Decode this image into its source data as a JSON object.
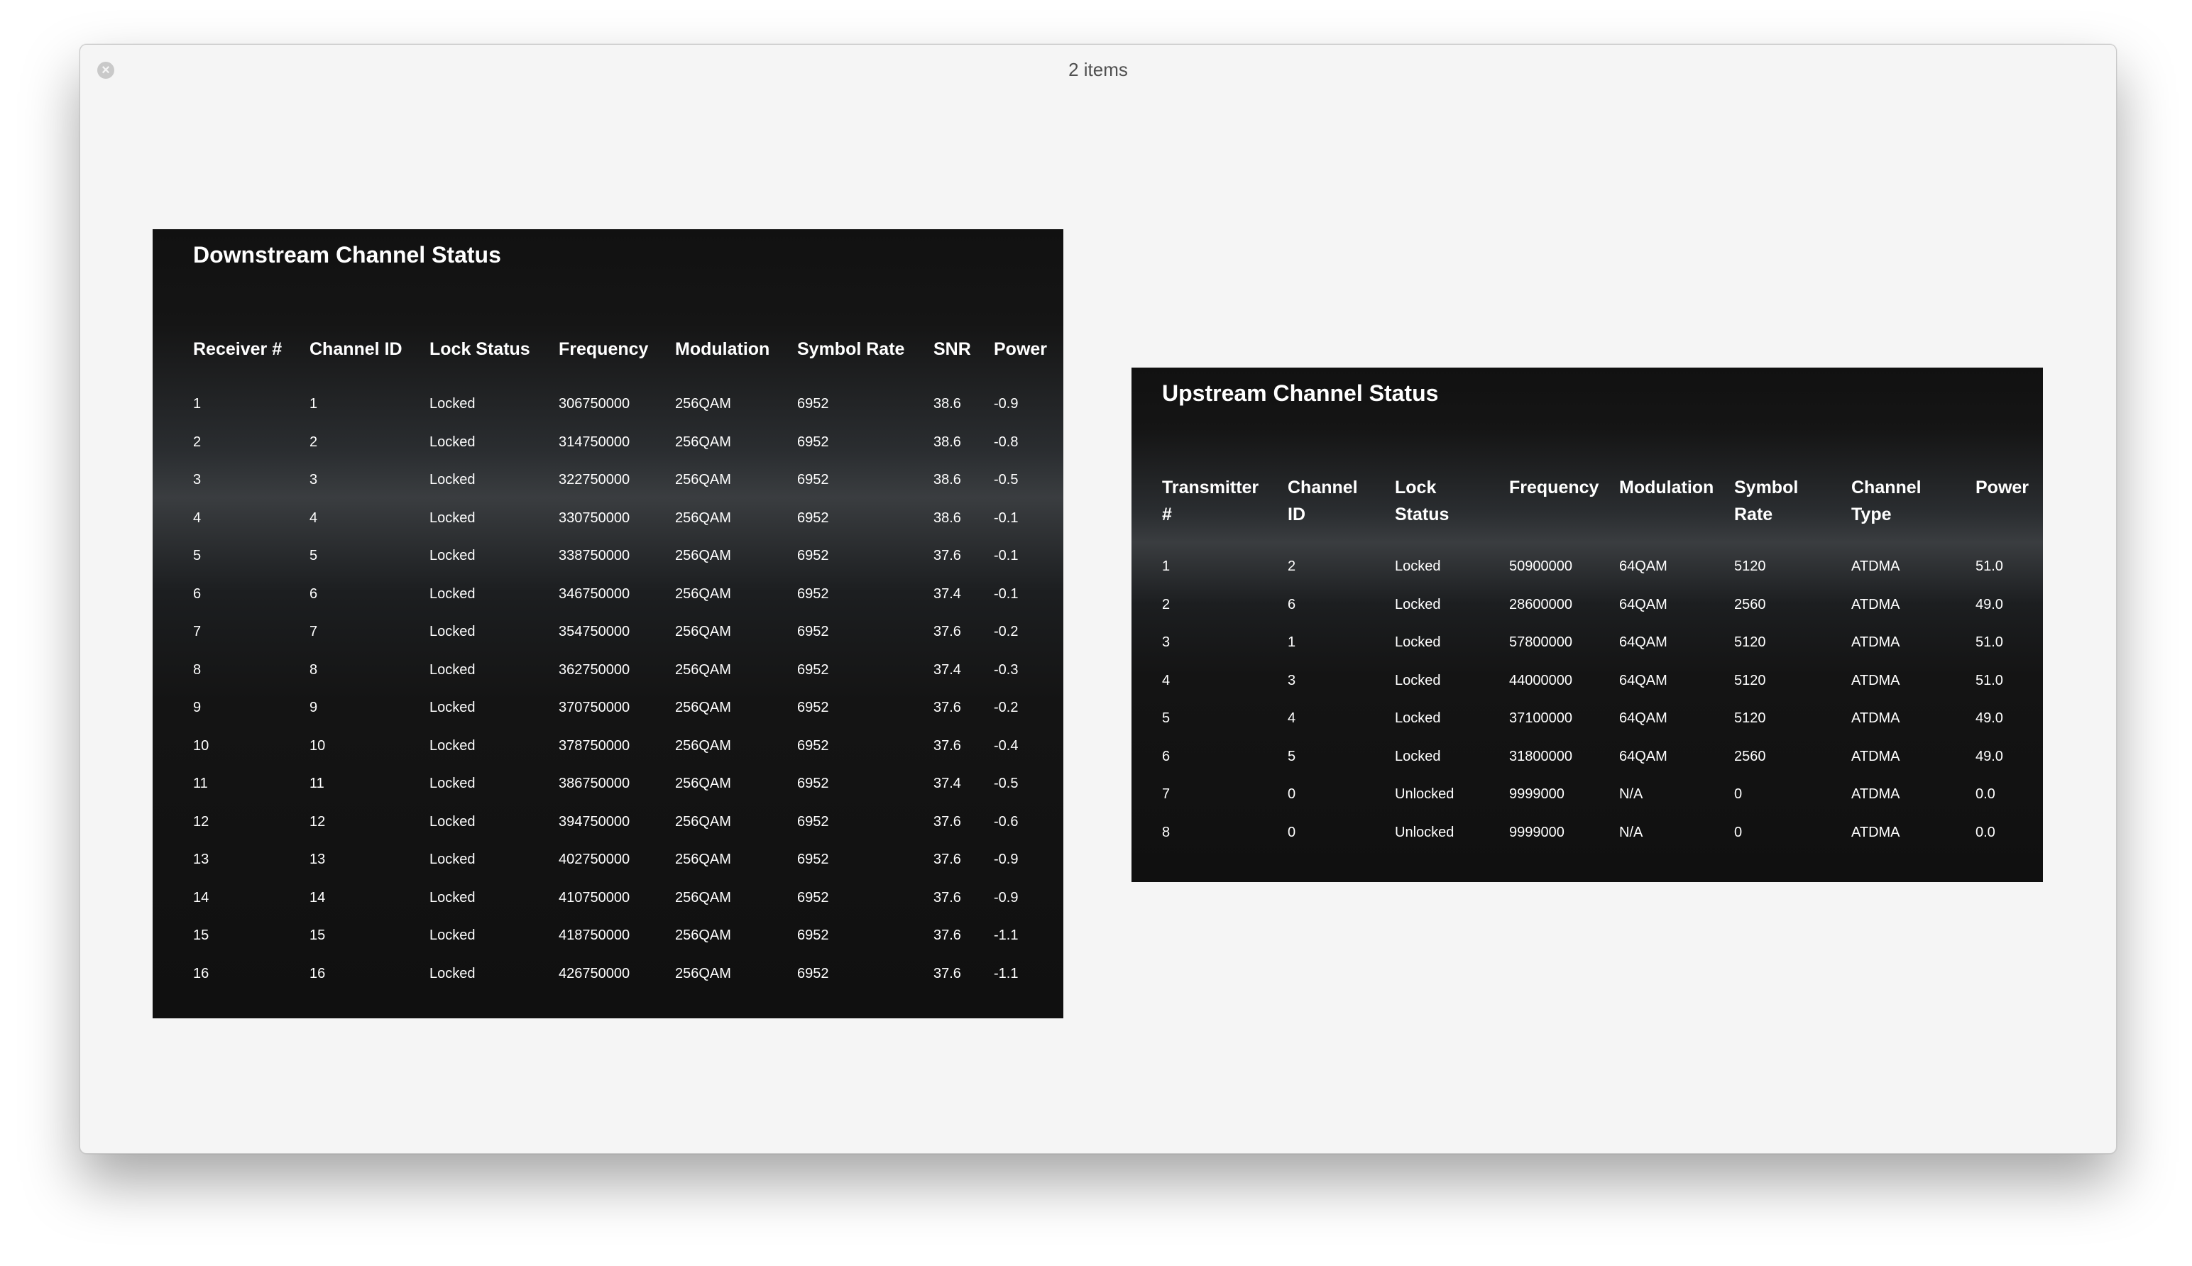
{
  "window": {
    "title": "2 items"
  },
  "downstream": {
    "title": "Downstream Channel Status",
    "headers": [
      "Receiver #",
      "Channel ID",
      "Lock Status",
      "Frequency",
      "Modulation",
      "Symbol Rate",
      "SNR",
      "Power"
    ],
    "rows": [
      [
        "1",
        "1",
        "Locked",
        "306750000",
        "256QAM",
        "6952",
        "38.6",
        "-0.9"
      ],
      [
        "2",
        "2",
        "Locked",
        "314750000",
        "256QAM",
        "6952",
        "38.6",
        "-0.8"
      ],
      [
        "3",
        "3",
        "Locked",
        "322750000",
        "256QAM",
        "6952",
        "38.6",
        "-0.5"
      ],
      [
        "4",
        "4",
        "Locked",
        "330750000",
        "256QAM",
        "6952",
        "38.6",
        "-0.1"
      ],
      [
        "5",
        "5",
        "Locked",
        "338750000",
        "256QAM",
        "6952",
        "37.6",
        "-0.1"
      ],
      [
        "6",
        "6",
        "Locked",
        "346750000",
        "256QAM",
        "6952",
        "37.4",
        "-0.1"
      ],
      [
        "7",
        "7",
        "Locked",
        "354750000",
        "256QAM",
        "6952",
        "37.6",
        "-0.2"
      ],
      [
        "8",
        "8",
        "Locked",
        "362750000",
        "256QAM",
        "6952",
        "37.4",
        "-0.3"
      ],
      [
        "9",
        "9",
        "Locked",
        "370750000",
        "256QAM",
        "6952",
        "37.6",
        "-0.2"
      ],
      [
        "10",
        "10",
        "Locked",
        "378750000",
        "256QAM",
        "6952",
        "37.6",
        "-0.4"
      ],
      [
        "11",
        "11",
        "Locked",
        "386750000",
        "256QAM",
        "6952",
        "37.4",
        "-0.5"
      ],
      [
        "12",
        "12",
        "Locked",
        "394750000",
        "256QAM",
        "6952",
        "37.6",
        "-0.6"
      ],
      [
        "13",
        "13",
        "Locked",
        "402750000",
        "256QAM",
        "6952",
        "37.6",
        "-0.9"
      ],
      [
        "14",
        "14",
        "Locked",
        "410750000",
        "256QAM",
        "6952",
        "37.6",
        "-0.9"
      ],
      [
        "15",
        "15",
        "Locked",
        "418750000",
        "256QAM",
        "6952",
        "37.6",
        "-1.1"
      ],
      [
        "16",
        "16",
        "Locked",
        "426750000",
        "256QAM",
        "6952",
        "37.6",
        "-1.1"
      ]
    ]
  },
  "upstream": {
    "title": "Upstream Channel Status",
    "headers": [
      "Transmitter\n#",
      "Channel\nID",
      "Lock\nStatus",
      "Frequency",
      "Modulation",
      "Symbol\nRate",
      "Channel\nType",
      "Power"
    ],
    "rows": [
      [
        "1",
        "2",
        "Locked",
        "50900000",
        "64QAM",
        "5120",
        "ATDMA",
        "51.0"
      ],
      [
        "2",
        "6",
        "Locked",
        "28600000",
        "64QAM",
        "2560",
        "ATDMA",
        "49.0"
      ],
      [
        "3",
        "1",
        "Locked",
        "57800000",
        "64QAM",
        "5120",
        "ATDMA",
        "51.0"
      ],
      [
        "4",
        "3",
        "Locked",
        "44000000",
        "64QAM",
        "5120",
        "ATDMA",
        "51.0"
      ],
      [
        "5",
        "4",
        "Locked",
        "37100000",
        "64QAM",
        "5120",
        "ATDMA",
        "49.0"
      ],
      [
        "6",
        "5",
        "Locked",
        "31800000",
        "64QAM",
        "2560",
        "ATDMA",
        "49.0"
      ],
      [
        "7",
        "0",
        "Unlocked",
        "9999000",
        "N/A",
        "0",
        "ATDMA",
        "0.0"
      ],
      [
        "8",
        "0",
        "Unlocked",
        "9999000",
        "N/A",
        "0",
        "ATDMA",
        "0.0"
      ]
    ]
  }
}
